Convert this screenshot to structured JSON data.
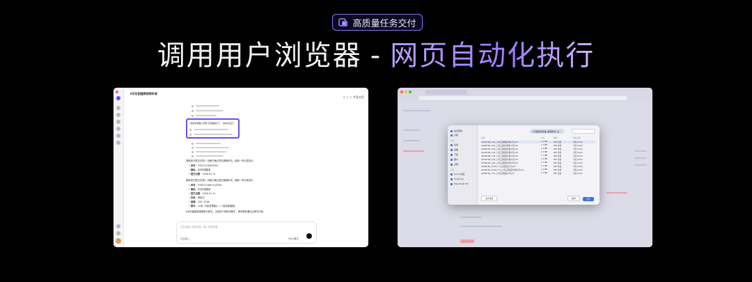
{
  "badge": {
    "text": "高质量任务交付",
    "icon": "task-deliver-icon"
  },
  "headline": {
    "part1": "调用用户浏览器",
    "separator": "-",
    "part2": "网页自动化执行"
  },
  "colors": {
    "accent": "#8b74ff",
    "highlight_box": "#6e4bf0",
    "background": "#000000"
  },
  "left_window": {
    "title": "6月份团建费报销申请",
    "top_right": "⊙ 三 ⇧ 共享对话",
    "highlight_text": "\"当前浏览器人员审\"该页面执行了，请你点击它\"",
    "section_intro": "搜索到已提交记录1: 页面已确认提交报销申请，最新一条记录显示：",
    "record1": [
      {
        "k": "单号",
        "v": "FYBX7136D20FS5"
      },
      {
        "k": "事由",
        "v": "6月份团建费"
      },
      {
        "k": "提交日期",
        "v": "2026-07-11"
      }
    ],
    "section_intro2": "搜索到已提交记录2: 页面已确认提交报销申请，最新一条记录显示：",
    "record2": [
      {
        "k": "单号",
        "v": "FYBX7136D27G5E96"
      },
      {
        "k": "事由",
        "v": "6月份团建费"
      },
      {
        "k": "提交日期",
        "v": "2026-07-11"
      },
      {
        "k": "状态",
        "v": "审批中"
      },
      {
        "k": "金额",
        "v": "CNY 78.60"
      },
      {
        "k": "附件",
        "v": "10张（6张发票图片 + 2张收款截图）"
      }
    ],
    "footer_note": "6月份团建费报销单已提交，当前处于审批流程中，等待审批通过后即可打款。",
    "input_placeholder": "请在此输入你的问题，输入/使用技能",
    "model_label": "Max 模式",
    "mode_label": "在此输入"
  },
  "right_window": {
    "dialog_folder": "6月团建费发票_报销附件_自...",
    "sidebar_sections": [
      "最近使用",
      "位置",
      "标签"
    ],
    "sidebar_items": [
      "最近使用",
      "文稿",
      "应用",
      "桌面",
      "下载",
      "图片",
      "文稿",
      "iCloud云盘",
      "OneDrive",
      "Macintosh HD"
    ],
    "columns": [
      "名称",
      "大小",
      "种类",
      "添加日期"
    ],
    "files": [
      [
        "20260706_3,45_上海三港餐饮有限公司.pdf",
        "1.2 MB",
        "PDF 文档",
        "今天 16:02"
      ],
      [
        "20260706_4,70_上海三港外卖服务公司.pdf",
        "1.1 MB",
        "PDF 文档",
        "今天 16:02"
      ],
      [
        "20260706_3,80_上海三港配送有限公司.pdf",
        "1.0 MB",
        "PDF 文档",
        "今天 16:02"
      ],
      [
        "20260706_5,05_上海三港配送有限公司.pdf",
        "1.2 MB",
        "PDF 文档",
        "今天 16:02"
      ],
      [
        "20260706_3,30_上海三港配送有限公司.pdf",
        "1.1 MB",
        "PDF 文档",
        "今天 16:02"
      ],
      [
        "20260706_4,40_上海三港配送有限公司.pdf",
        "1.0 MB",
        "PDF 文档",
        "今天 16:02"
      ],
      [
        "20260706_3,60_上海三港配送有限公司.pdf",
        "1.2 MB",
        "PDF 文档",
        "今天 16:02"
      ],
      [
        "20260706_25,00_广州三港配送公司.pdf",
        "1.1 MB",
        "PDF 文档",
        "今天 16:02"
      ],
      [
        "20260706_25,00_广州_上海三港配送有限公司.pdf",
        "1.0 MB",
        "PDF 文档",
        "今天 16:02"
      ],
      [
        "20260706_1,15_上海三港配送公司.pdf",
        "1.2 MB",
        "PDF 文档",
        "今天 16:02"
      ]
    ],
    "btn_options": "显示选项",
    "btn_cancel": "取消",
    "btn_open": "打开"
  }
}
